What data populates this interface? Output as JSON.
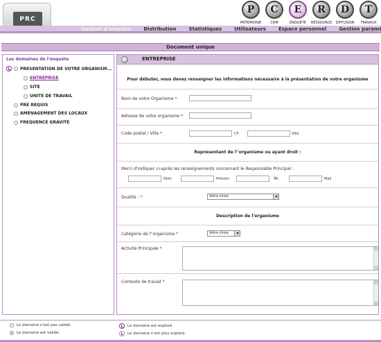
{
  "modules": [
    {
      "letter": "P",
      "label": "PATRIMOINE"
    },
    {
      "letter": "C",
      "label": "CRM"
    },
    {
      "letter": "E",
      "label": "ENQUETE",
      "active": true
    },
    {
      "letter": "R",
      "label": "RESSOURCE"
    },
    {
      "letter": "D",
      "label": "DIFFUSION"
    },
    {
      "letter": "T",
      "label": "TRAVAUX"
    }
  ],
  "logo": {
    "text": "PRC"
  },
  "nav": [
    {
      "label": "Gestion d'enquête",
      "active": true
    },
    {
      "label": "Distribution"
    },
    {
      "label": "Statistiques"
    },
    {
      "label": "Utilisateurs"
    },
    {
      "label": "Espace personnel"
    },
    {
      "label": "Gestion paramètres"
    }
  ],
  "doc_title": "Document unique",
  "sidebar": {
    "title": "Les domaines de l'enquête",
    "items": [
      {
        "label": "PRESENTATION DE VOTRE ORGANISM...",
        "level": 0,
        "state": "explored"
      },
      {
        "label": "ENTREPRISE",
        "level": 1,
        "state": "current"
      },
      {
        "label": "SITE",
        "level": 1,
        "state": "none"
      },
      {
        "label": "UNITE DE TRAVAIL",
        "level": 1,
        "state": "none"
      },
      {
        "label": "PRE REQUIS",
        "level": 0,
        "state": "none"
      },
      {
        "label": "AMÉNAGEMENT DES LOCAUX",
        "level": 0,
        "state": "none"
      },
      {
        "label": "FREQUENCE GRAVITE",
        "level": 0,
        "state": "none"
      }
    ]
  },
  "form": {
    "section_title": "ENTREPRISE",
    "intro": "Pour débuter, vous devez renseigner les informations nécessaire à la présentation de votre organisme",
    "nom_label": "Nom de votre Organisme",
    "adresse_label": "Adresse de votre organisme",
    "cp_label": "Code postal / Ville",
    "cp_small": "CP",
    "ville_small": "Ville",
    "req_mark": "*",
    "rep_title": "Représentant de l''organisme ou ayant droit :",
    "rep_intro": "Merci d'indiquer ci-après les renseignements concernant le Responsable Principal :",
    "rep_fields": [
      "Nom",
      "Prénom",
      "Tél",
      "Mail"
    ],
    "qualite_label": "Qualité :",
    "qualite_value": "Votre choix",
    "desc_title": "Description de l'organisme",
    "categorie_label": "Catégorie de l''organisme",
    "categorie_value": "Votre choix",
    "activite_label": "Activité Principale",
    "contexte_label": "Contexte de travail"
  },
  "legend": {
    "not_validated": "Le domaine n'est pas validé.",
    "validated": "Le domaine est validé.",
    "explored": "Le domaine est exploré.",
    "not_explored": "Le domaine n'est plus exploré."
  }
}
